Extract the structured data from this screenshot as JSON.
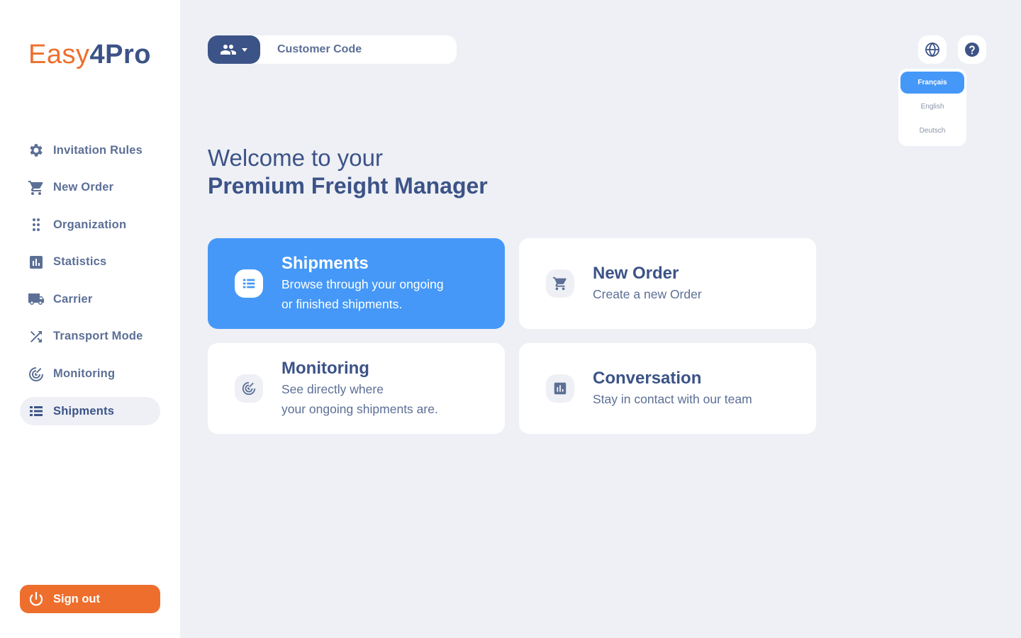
{
  "brand": {
    "part1": "Easy",
    "part2": "4Pro"
  },
  "sidebar": {
    "items": [
      {
        "label": "Invitation Rules",
        "icon": "gear-icon"
      },
      {
        "label": "New Order",
        "icon": "cart-icon"
      },
      {
        "label": "Organization",
        "icon": "dots-grid-icon"
      },
      {
        "label": "Statistics",
        "icon": "bar-chart-icon"
      },
      {
        "label": "Carrier",
        "icon": "truck-icon"
      },
      {
        "label": "Transport Mode",
        "icon": "shuffle-icon"
      },
      {
        "label": "Monitoring",
        "icon": "radar-icon"
      },
      {
        "label": "Shipments",
        "icon": "list-icon"
      }
    ],
    "active": "Shipments",
    "signout_label": "Sign out"
  },
  "topbar": {
    "customer_placeholder": "Customer Code"
  },
  "languages": {
    "options": [
      "Français",
      "English",
      "Deutsch"
    ],
    "selected": "Français"
  },
  "welcome": {
    "line1": "Welcome to your",
    "line2": "Premium Freight Manager"
  },
  "cards": [
    {
      "title": "Shipments",
      "desc1": "Browse through your ongoing",
      "desc2": "or finished shipments.",
      "icon": "list-icon",
      "active": true
    },
    {
      "title": "New Order",
      "desc1": "Create a new Order",
      "desc2": "",
      "icon": "cart-icon",
      "active": false
    },
    {
      "title": "Monitoring",
      "desc1": "See directly where",
      "desc2": "your ongoing shipments are.",
      "icon": "radar-icon",
      "active": false
    },
    {
      "title": "Conversation",
      "desc1": "Stay in contact with our team",
      "desc2": "",
      "icon": "bar-chart-icon",
      "active": false
    }
  ],
  "colors": {
    "accent_blue": "#4598f7",
    "navy": "#3c5387",
    "orange": "#ee6f2d",
    "background": "#eef0f5"
  }
}
